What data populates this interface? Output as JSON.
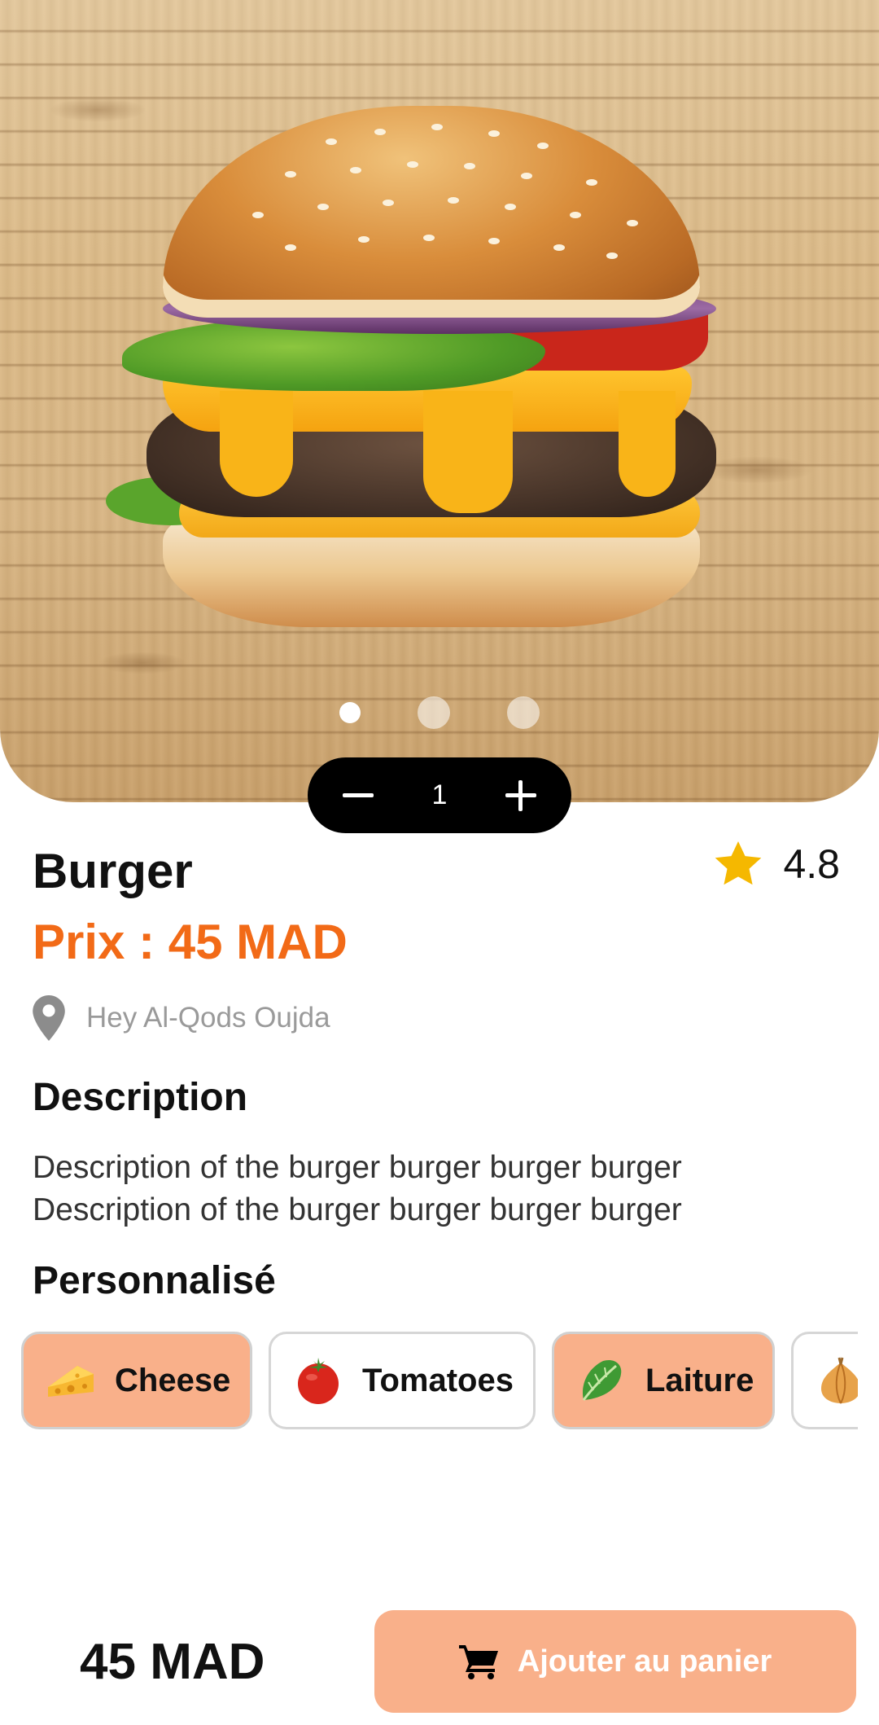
{
  "product": {
    "name": "Burger",
    "price_label": "Prix : 45 MAD",
    "rating": "4.8",
    "location": "Hey Al-Qods Oujda",
    "image_icon": "burger-photo",
    "carousel": {
      "count": 3,
      "active_index": 0
    }
  },
  "quantity": {
    "value": "1",
    "minus_icon": "minus-icon",
    "plus_icon": "plus-icon"
  },
  "description": {
    "title": "Description",
    "text_line1": "Description of the burger burger burger burger",
    "text_line2": "Description of the burger burger burger burger"
  },
  "customize": {
    "title": "Personnalisé",
    "options": [
      {
        "label": "Cheese",
        "icon": "cheese-icon",
        "selected": true
      },
      {
        "label": "Tomatoes",
        "icon": "tomato-icon",
        "selected": false
      },
      {
        "label": "Laiture",
        "icon": "lettuce-icon",
        "selected": true
      },
      {
        "label": "",
        "icon": "onion-icon",
        "selected": false
      }
    ]
  },
  "footer": {
    "total": "45 MAD",
    "add_label": "Ajouter au panier",
    "cart_icon": "cart-icon"
  },
  "colors": {
    "accent_orange": "#f26a17",
    "chip_selected": "#f9b08a",
    "star": "#f5b800"
  }
}
